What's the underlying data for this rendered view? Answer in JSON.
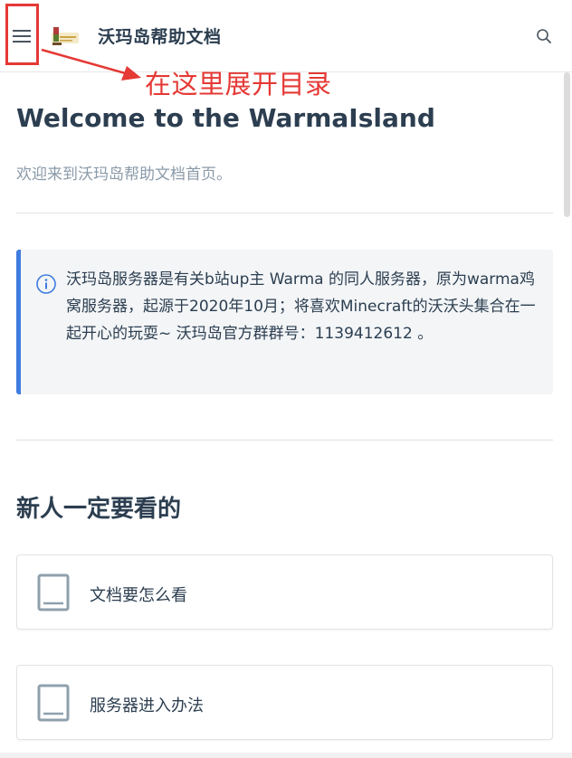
{
  "header": {
    "menu_icon": "hamburger-menu-icon",
    "logo_icon": "site-logo",
    "site_title": "沃玛岛帮助文档",
    "search_icon": "search-icon"
  },
  "annotation": {
    "text": "在这里展开目录",
    "color": "#e53935"
  },
  "main": {
    "title": "Welcome to the WarmaIsland",
    "subtitle": "欢迎来到沃玛岛帮助文档首页。",
    "tip": {
      "icon": "info-icon",
      "text": "沃玛岛服务器是有关b站up主 Warma 的同人服务器，原为warma鸡窝服务器，起源于2020年10月；将喜欢Minecraft的沃沃头集合在一起开心的玩耍~ 沃玛岛官方群群号：1139412612 。",
      "accent": "#3f7be0"
    },
    "section_title": "新人一定要看的",
    "cards": [
      {
        "label": "文档要怎么看",
        "icon": "document-icon"
      },
      {
        "label": "服务器进入办法",
        "icon": "document-icon"
      }
    ]
  }
}
